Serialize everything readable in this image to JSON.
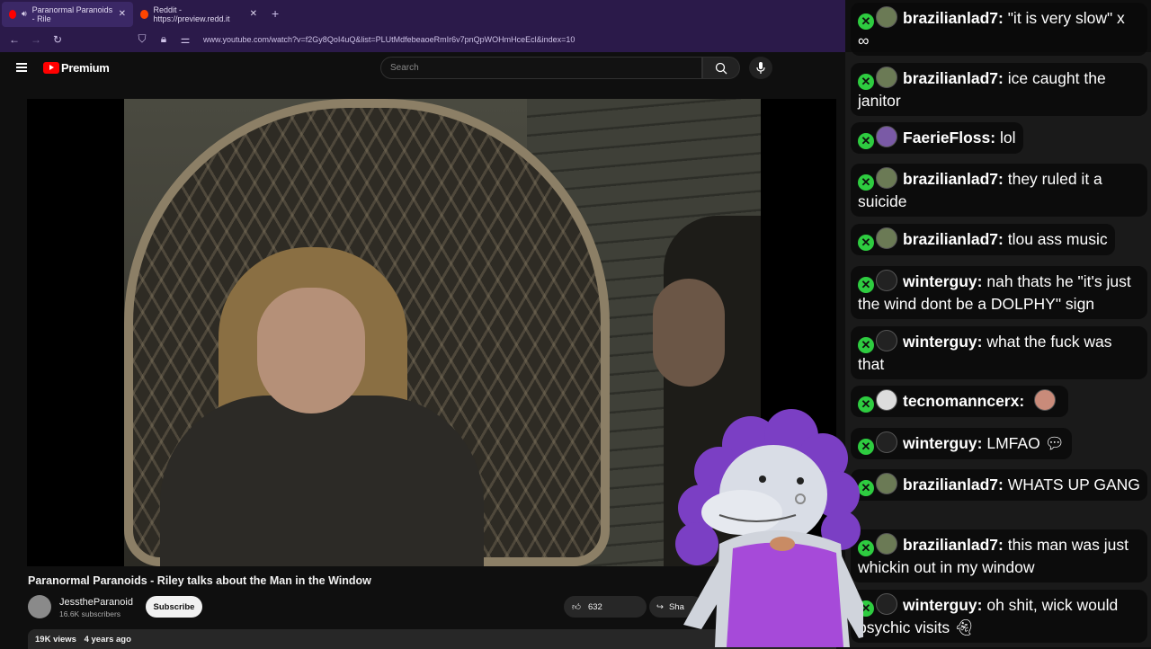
{
  "browser": {
    "tabs": [
      {
        "title": "Paranormal Paranoids - Rile",
        "active": true
      },
      {
        "title": "Reddit - https://preview.redd.it",
        "active": false
      }
    ],
    "new_tab_label": "+",
    "url": "www.youtube.com/watch?v=f2Gy8QoI4uQ&list=PLUtMdfebeaoeRmIr6v7pnQpWOHmHceEcl&index=10",
    "colors": {
      "accent": "#2b1a4a"
    }
  },
  "youtube": {
    "brand": "Premium",
    "search_placeholder": "Search",
    "video": {
      "title": "Paranormal Paranoids - Riley talks about the Man in the Window",
      "channel": "JesstheParanoid",
      "subscribers": "16.6K subscribers",
      "subscribe_label": "Subscribe",
      "likes": "632",
      "share_label": "Sha",
      "views": "19K views",
      "age": "4 years ago"
    }
  },
  "chat": {
    "badge_icon": "mod-x-badge",
    "messages": [
      {
        "user": "brazilianlad7:",
        "text": "\"it is very slow\" x ∞",
        "avatar_color": "#6b7a55"
      },
      {
        "user": "brazilianlad7:",
        "text": "ice caught the janitor",
        "avatar_color": "#6b7a55"
      },
      {
        "user": "FaerieFloss:",
        "text": "lol",
        "avatar_color": "#7a5aa6"
      },
      {
        "user": "brazilianlad7:",
        "text": "they ruled it a suicide",
        "avatar_color": "#6b7a55"
      },
      {
        "user": "brazilianlad7:",
        "text": "tlou ass music",
        "avatar_color": "#6b7a55"
      },
      {
        "user": "winterguy:",
        "text": "nah thats he \"it's just the wind dont be a DOLPHY\" sign",
        "avatar_color": "#222222"
      },
      {
        "user": "winterguy:",
        "text": "what the fuck was that",
        "avatar_color": "#222222"
      },
      {
        "user": "tecnomanncerx:",
        "text": "",
        "avatar_color": "#dddddd"
      },
      {
        "user": "winterguy:",
        "text": "LMFAO",
        "avatar_color": "#222222"
      },
      {
        "user": "brazilianlad7:",
        "text": "WHATS UP GANG",
        "avatar_color": "#6b7a55"
      },
      {
        "user": "brazilianlad7:",
        "text": "this man was just whickin out in my window",
        "avatar_color": "#6b7a55"
      },
      {
        "user": "winterguy:",
        "text": "oh shit, wick would psychic visits",
        "avatar_color": "#222222"
      }
    ]
  }
}
